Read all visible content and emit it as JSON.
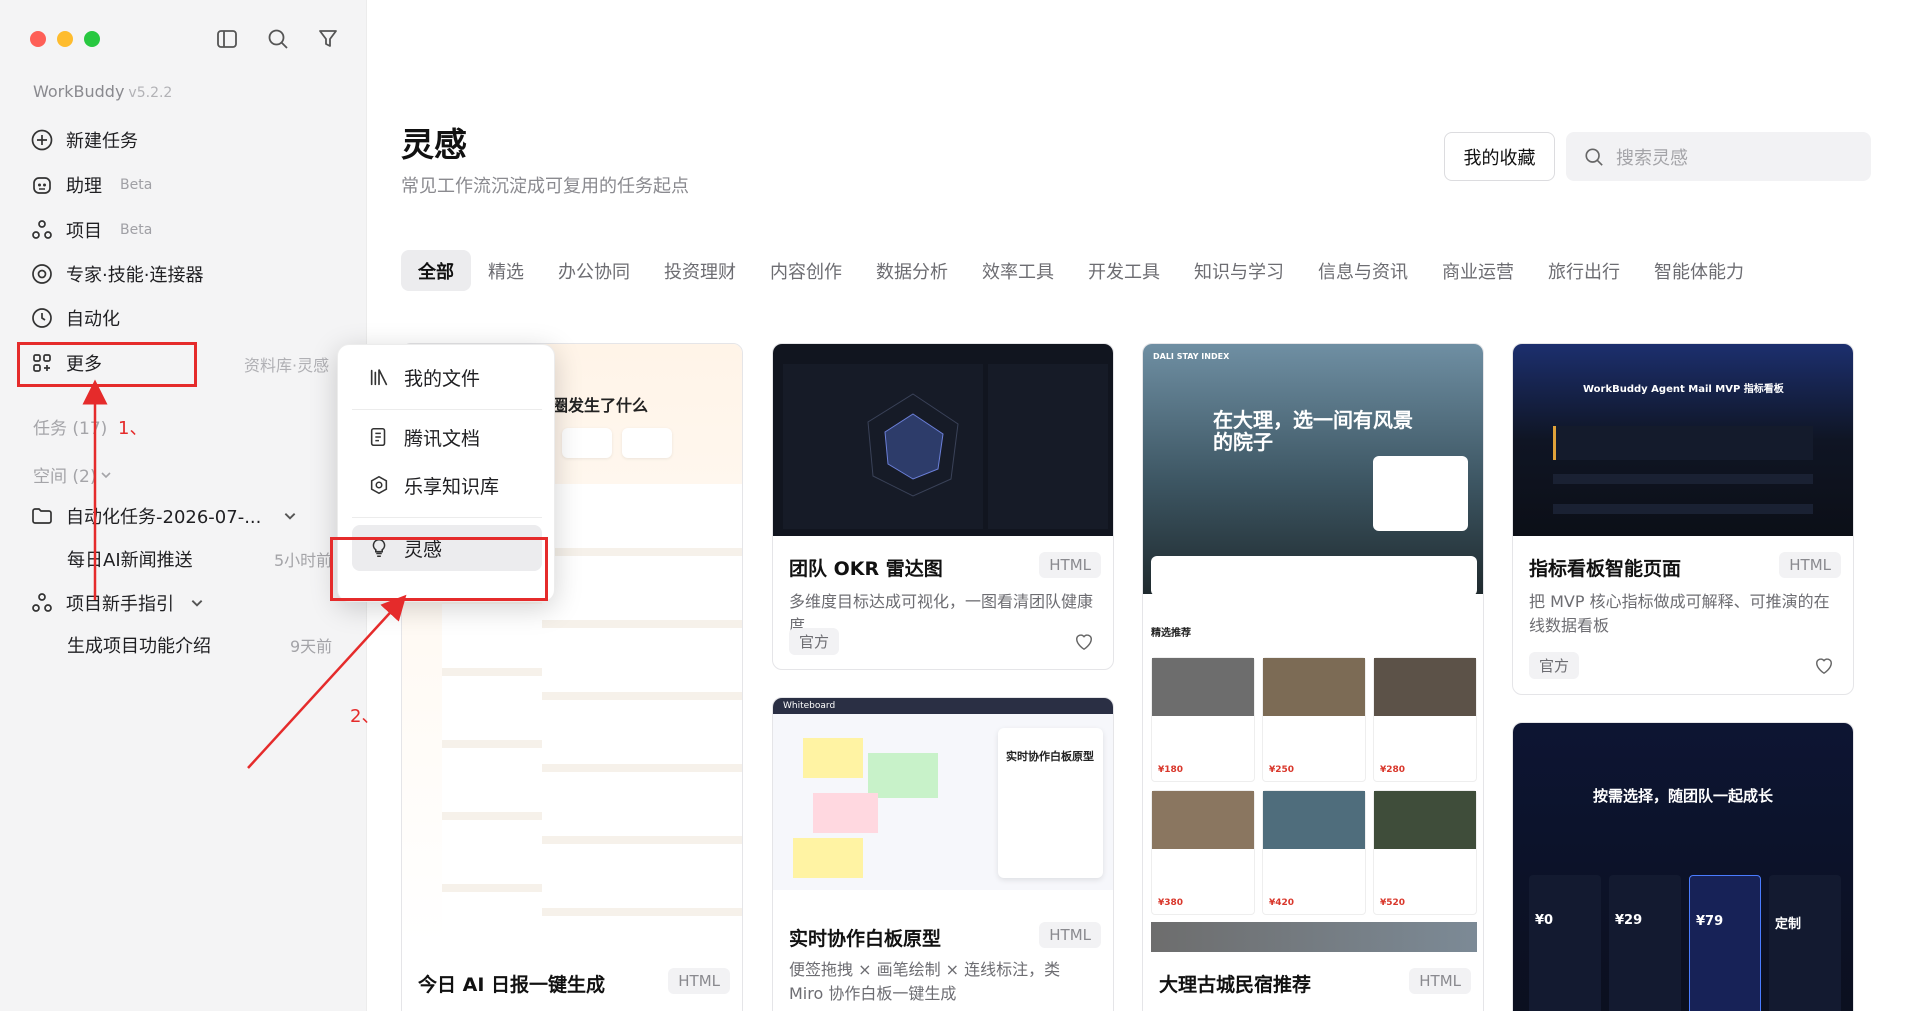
{
  "app": {
    "name": "WorkBuddy",
    "version": "v5.2.2"
  },
  "sidebar": {
    "nav": [
      {
        "label": "新建任务",
        "badge": ""
      },
      {
        "label": "助理",
        "badge": "Beta"
      },
      {
        "label": "项目",
        "badge": "Beta"
      },
      {
        "label": "专家·技能·连接器",
        "badge": ""
      },
      {
        "label": "自动化",
        "badge": ""
      },
      {
        "label": "更多",
        "badge": ""
      }
    ],
    "more_hint": "资料库·灵感",
    "tasks_label": "任务 (17)",
    "spaces_label": "空间 (2)",
    "spaces": [
      {
        "label": "自动化任务-2026-07-...",
        "children": [
          {
            "label": "每日AI新闻推送",
            "time": "5小时前"
          }
        ]
      },
      {
        "label": "项目新手指引",
        "children": [
          {
            "label": "生成项目功能介绍",
            "time": "9天前"
          }
        ]
      }
    ]
  },
  "annotations": {
    "step1": "1、",
    "step2": "2、",
    "color": "#e52b2b"
  },
  "more_menu": {
    "items": [
      {
        "label": "我的文件",
        "icon": "files-icon"
      },
      {
        "label": "腾讯文档",
        "icon": "docs-icon"
      },
      {
        "label": "乐享知识库",
        "icon": "knowledge-icon"
      },
      {
        "label": "灵感",
        "icon": "lightbulb-icon"
      }
    ]
  },
  "header": {
    "title": "灵感",
    "subtitle": "常见工作流沉淀成可复用的任务起点",
    "favorites_label": "我的收藏",
    "search_placeholder": "搜索灵感"
  },
  "tabs": [
    "全部",
    "精选",
    "办公协同",
    "投资理财",
    "内容创作",
    "数据分析",
    "效率工具",
    "开发工具",
    "知识与学习",
    "信息与资讯",
    "商业运营",
    "旅行出行",
    "智能体能力"
  ],
  "active_tab": "全部",
  "cards": [
    {
      "title": "今日 AI 日报一键生成",
      "format": "HTML",
      "preview_heading": "圈发生了什么"
    },
    {
      "title": "团队 OKR 雷达图",
      "format": "HTML",
      "desc": "多维度目标达成可视化，一图看清团队健康度",
      "tag": "官方"
    },
    {
      "title": "实时协作白板原型",
      "format": "HTML",
      "desc": "便签拖拽 × 画笔绘制 × 连线标注，类 Miro 协作白板一键生成",
      "preview_app": "Whiteboard",
      "preview_heading": "实时协作白板原型"
    },
    {
      "title": "大理古城民宿推荐",
      "format": "HTML",
      "preview_index": "DALI STAY INDEX",
      "preview_heading": "在大理，选一间有风景的院子",
      "preview_section": "精选推荐",
      "preview_prices": [
        "¥180",
        "¥250",
        "¥280",
        "¥380",
        "¥420",
        "¥520"
      ]
    },
    {
      "title": "指标看板智能页面",
      "format": "HTML",
      "desc": "把 MVP 核心指标做成可解释、可推演的在线数据看板",
      "tag": "官方",
      "preview_heading": "WorkBuddy Agent Mail MVP 指标看板"
    },
    {
      "preview_heading": "按需选择，随团队一起成长",
      "preview_prices": [
        "¥0",
        "¥29",
        "¥79",
        "定制"
      ]
    }
  ]
}
